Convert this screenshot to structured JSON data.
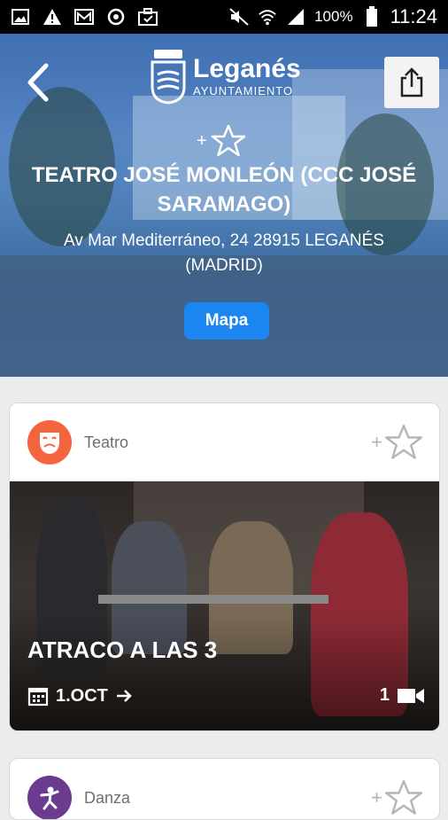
{
  "status_bar": {
    "battery_percent": "100%",
    "time": "11:24"
  },
  "header": {
    "logo_name": "Leganés",
    "logo_sub": "AYUNTAMIENTO",
    "fav_plus": "+",
    "title": "TEATRO JOSÉ MONLEÓN (CCC JOSÉ SARAMAGO)",
    "address": "Av Mar Mediterráneo, 24 28915 LEGANÉS (MADRID)",
    "map_button": "Mapa"
  },
  "events": [
    {
      "category": "Teatro",
      "category_color": "#f2653f",
      "fav_plus": "+",
      "title": "ATRACO A LAS 3",
      "date": "1.OCT",
      "count": "1"
    },
    {
      "category": "Danza",
      "category_color": "#6a3b8f",
      "fav_plus": "+"
    }
  ],
  "icons": [
    "image-icon",
    "warning-icon",
    "mail-icon",
    "sync-icon",
    "briefcase-icon",
    "mute-icon",
    "wifi-icon",
    "signal-icon",
    "battery-icon",
    "back-icon",
    "share-icon",
    "star-icon",
    "theater-mask-icon",
    "calendar-icon",
    "arrow-right-icon",
    "video-icon",
    "dance-icon"
  ]
}
